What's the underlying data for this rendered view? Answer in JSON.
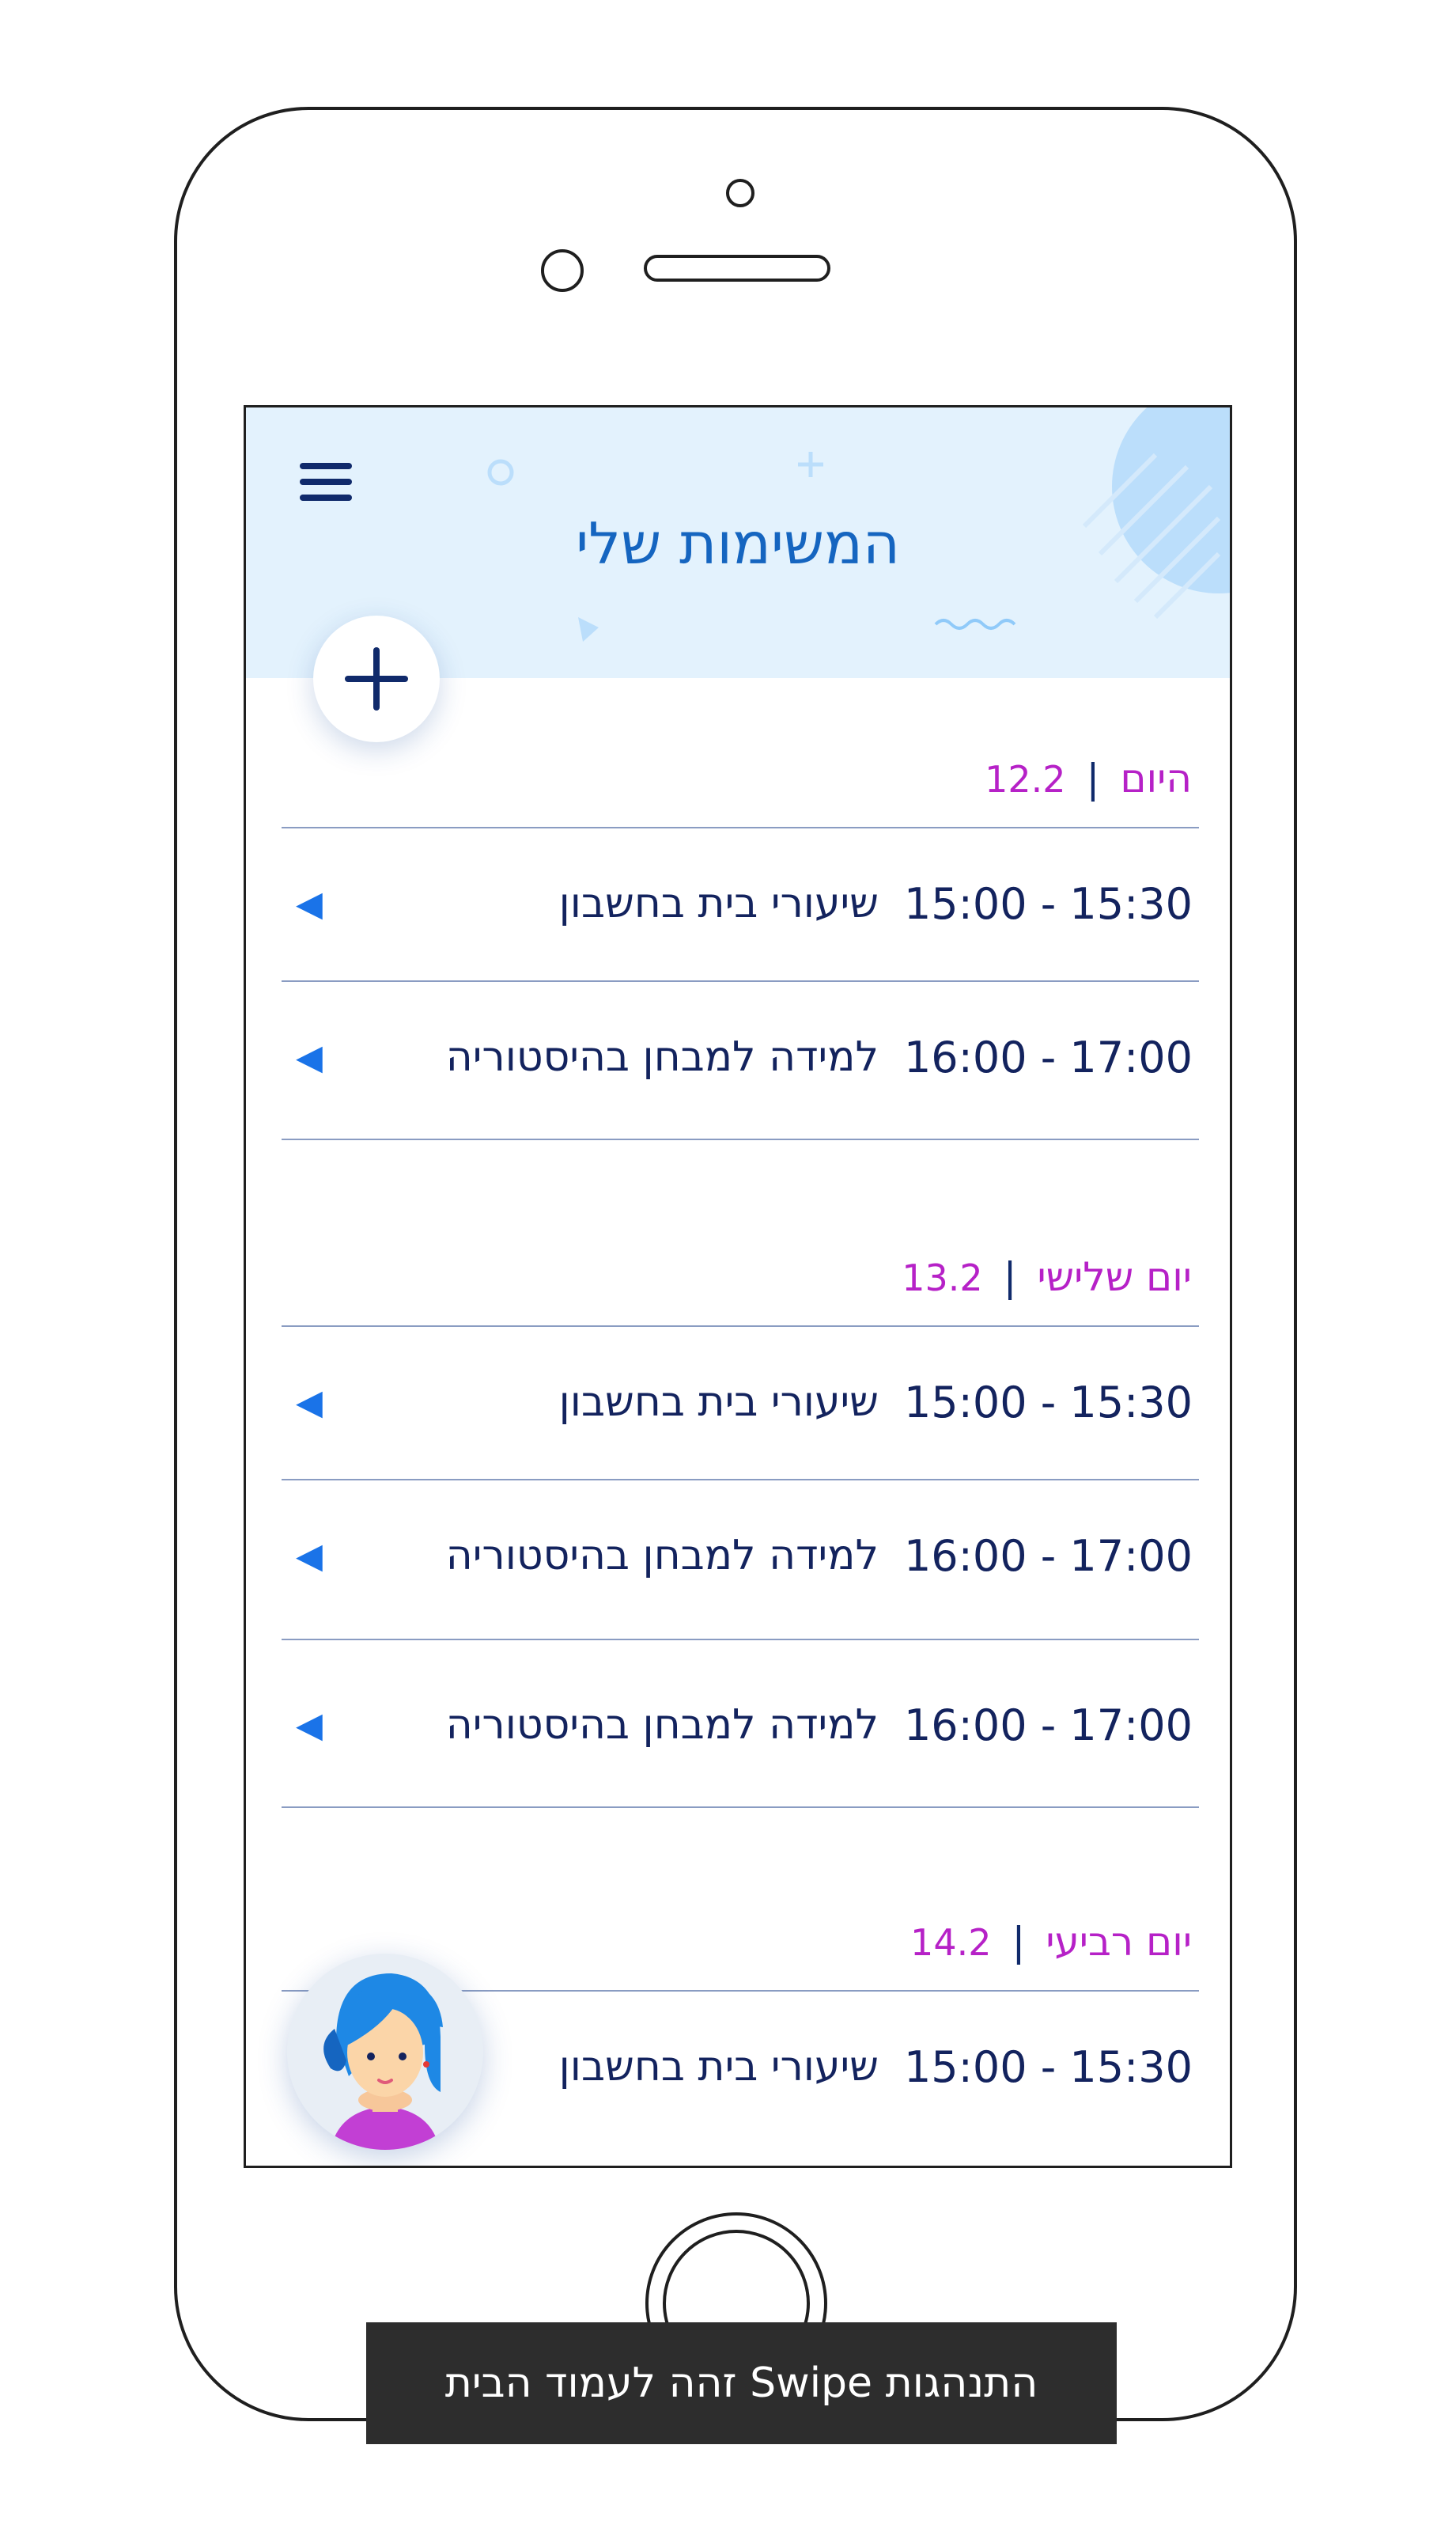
{
  "header": {
    "title": "המשימות שלי",
    "menu_icon": "hamburger-icon",
    "add_icon": "plus-icon"
  },
  "days": [
    {
      "label": "היום",
      "date": "12.2",
      "tasks": [
        {
          "time": "15:00 - 15:30",
          "title": "שיעורי בית בחשבון",
          "icon": "◀"
        },
        {
          "time": "16:00 - 17:00",
          "title": "למידה למבחן בהיסטוריה",
          "icon": "◀"
        }
      ]
    },
    {
      "label": "יום שלישי",
      "date": "13.2",
      "tasks": [
        {
          "time": "15:00 - 15:30",
          "title": "שיעורי בית בחשבון",
          "icon": "◀"
        },
        {
          "time": "16:00 - 17:00",
          "title": "למידה למבחן בהיסטוריה",
          "icon": "◀"
        },
        {
          "time": "16:00 - 17:00",
          "title": "למידה למבחן בהיסטוריה",
          "icon": "◀"
        }
      ]
    },
    {
      "label": "יום רביעי",
      "date": "14.2",
      "tasks": [
        {
          "time": "15:00 - 15:30",
          "title": "שיעורי בית בחשבון"
        }
      ]
    }
  ],
  "toast": {
    "text": "התנהגות Swipe זהה לעמוד הבית"
  },
  "colors": {
    "header_bg": "#e3f2fd",
    "title": "#1565c0",
    "day_label": "#b621c7",
    "text": "#13235e",
    "arrow": "#1a73e8"
  }
}
